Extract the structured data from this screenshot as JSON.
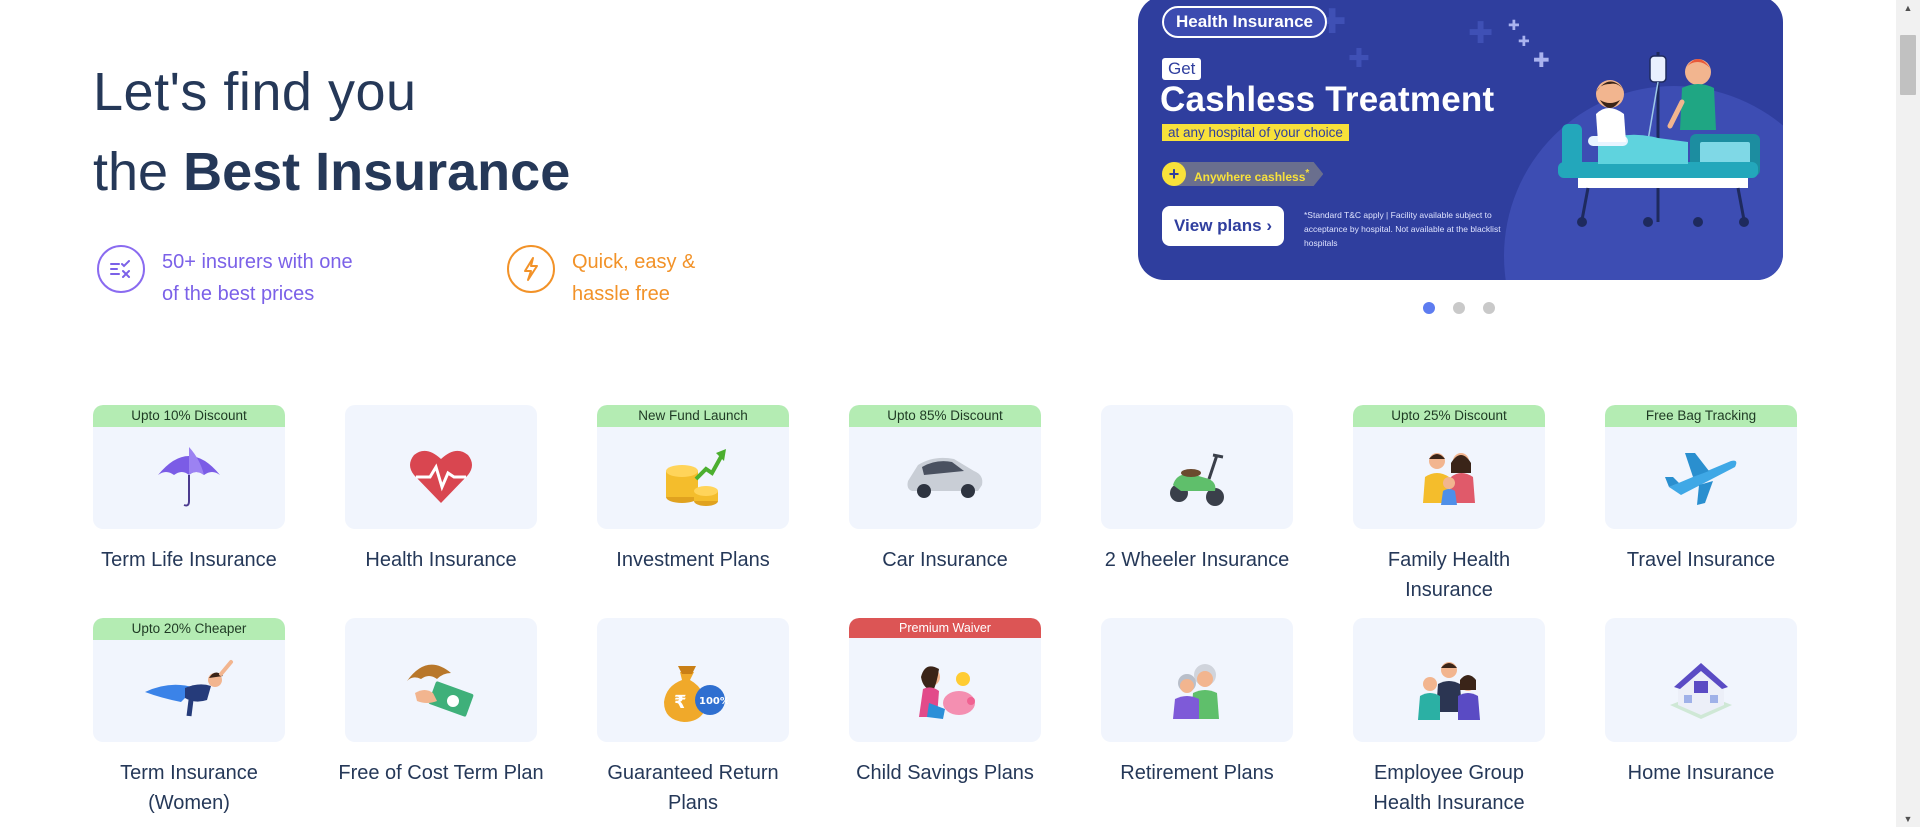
{
  "hero": {
    "line1": "Let's find you",
    "line2_prefix": "the ",
    "line2_bold": "Best Insurance"
  },
  "features": [
    {
      "line1": "50+ insurers with one",
      "line2": "of the best prices",
      "icon": "compare-list-icon",
      "color": "#7b61e8"
    },
    {
      "line1": "Quick, easy &",
      "line2": "hassle free",
      "icon": "lightning-icon",
      "color": "#f29228"
    }
  ],
  "banner": {
    "tag": "Health Insurance",
    "get": "Get",
    "title": "Cashless Treatment",
    "subtitle": "at any hospital of your choice",
    "pill": "Anywhere cashless",
    "pill_sup": "*",
    "cta": "View plans",
    "note": "*Standard T&C apply | Facility available subject to acceptance by hospital. Not available at the blacklist hospitals",
    "illustration": "hospital-bed-illustration",
    "bg_color": "#2f3e9e"
  },
  "carousel": {
    "slides": 3,
    "active": 1
  },
  "products": [
    {
      "label": "Term Life Insurance",
      "badge": "Upto 10% Discount",
      "icon": "umbrella-icon"
    },
    {
      "label": "Health Insurance",
      "badge": "",
      "icon": "heart-pulse-icon"
    },
    {
      "label": "Investment Plans",
      "badge": "New Fund Launch",
      "icon": "coins-growth-icon"
    },
    {
      "label": "Car Insurance",
      "badge": "Upto 85% Discount",
      "icon": "car-icon"
    },
    {
      "label": "2 Wheeler Insurance",
      "badge": "",
      "icon": "scooter-icon"
    },
    {
      "label": "Family Health Insurance",
      "badge": "Upto 25% Discount",
      "icon": "family-icon"
    },
    {
      "label": "Travel Insurance",
      "badge": "Free Bag Tracking",
      "icon": "airplane-icon"
    },
    {
      "label": "Term Insurance (Women)",
      "badge": "Upto 20% Cheaper",
      "icon": "superwoman-icon"
    },
    {
      "label": "Free of Cost Term Plan",
      "badge": "",
      "icon": "money-umbrella-icon"
    },
    {
      "label": "Guaranteed Return Plans",
      "badge": "",
      "icon": "money-bag-100-icon"
    },
    {
      "label": "Child Savings Plans",
      "badge": "Premium Waiver",
      "badge_style": "red",
      "icon": "child-piggybank-icon"
    },
    {
      "label": "Retirement Plans",
      "badge": "",
      "icon": "elderly-couple-icon"
    },
    {
      "label": "Employee Group Health Insurance",
      "badge": "",
      "icon": "employees-group-icon"
    },
    {
      "label": "Home Insurance",
      "badge": "",
      "icon": "house-icon"
    }
  ]
}
